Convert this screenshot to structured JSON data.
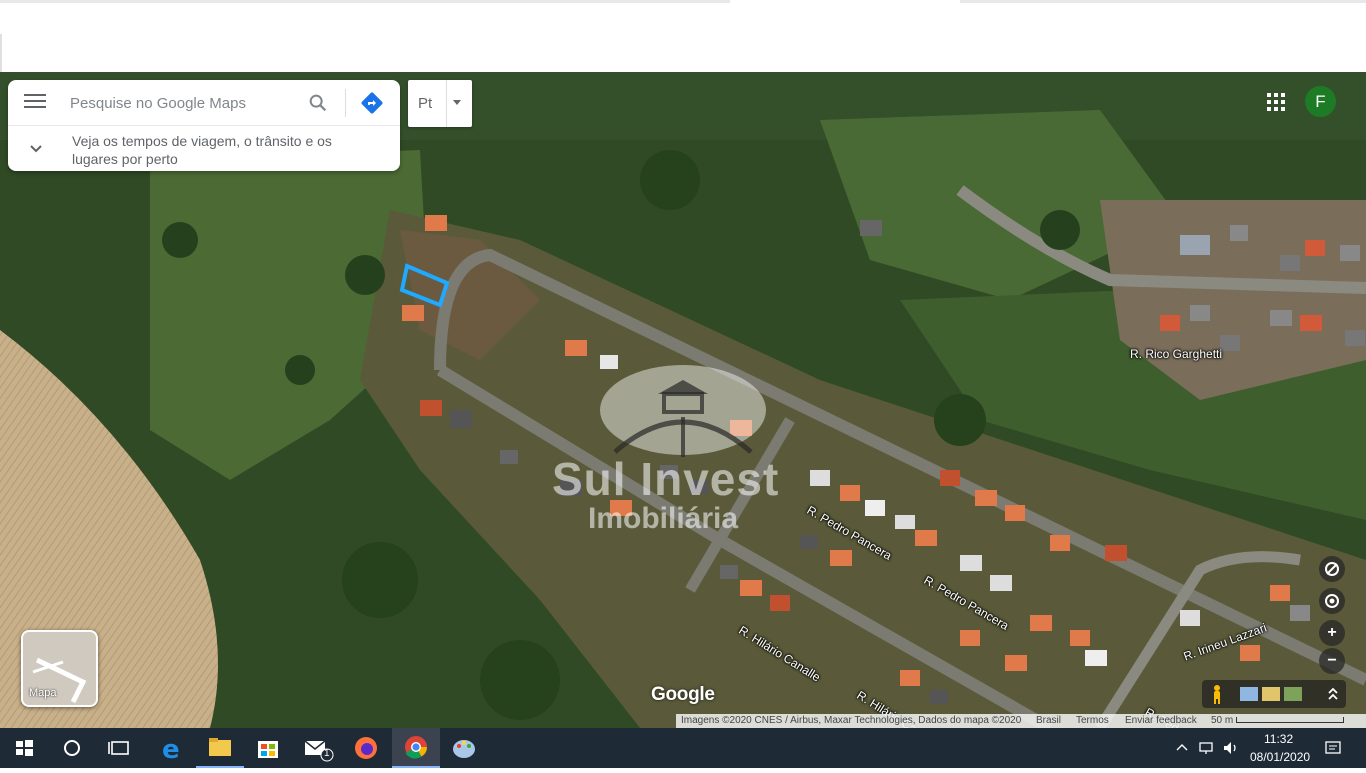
{
  "search": {
    "placeholder": "Pesquise no Google Maps",
    "expand_text": "Veja os tempos de viagem, o trânsito e os lugares por perto"
  },
  "photo_selector": {
    "label": "Pt"
  },
  "account": {
    "initial": "F",
    "avatar_color": "#1e7b25"
  },
  "streets": [
    "R. Rico Garghetti",
    "R. Pedro Pancera",
    "R. Pedro Pancera",
    "R. Hilário Canalle",
    "R. Hilário Canalle",
    "R. Irineu Lazzari",
    "R. Pedro Pancera"
  ],
  "watermark": {
    "brand": "Sul Invest",
    "subtitle": "Imobiliária"
  },
  "layer_switch": {
    "label": "Mapa"
  },
  "google_logo": "Google",
  "attribution": {
    "imagery": "Imagens ©2020 CNES / Airbus, Maxar Technologies, Dados do mapa ©2020",
    "country": "Brasil",
    "terms": "Termos",
    "feedback": "Enviar feedback",
    "scale": "50 m"
  },
  "map_controls": {
    "zoom_in": "+",
    "zoom_out": "−"
  },
  "taskbar": {
    "time": "11:32",
    "date": "08/01/2020",
    "mail_badge": "1",
    "accent_color": "#8ab4f8"
  },
  "colors": {
    "selection_outline": "#1fa9ff",
    "brand_blue": "#4285f4"
  }
}
